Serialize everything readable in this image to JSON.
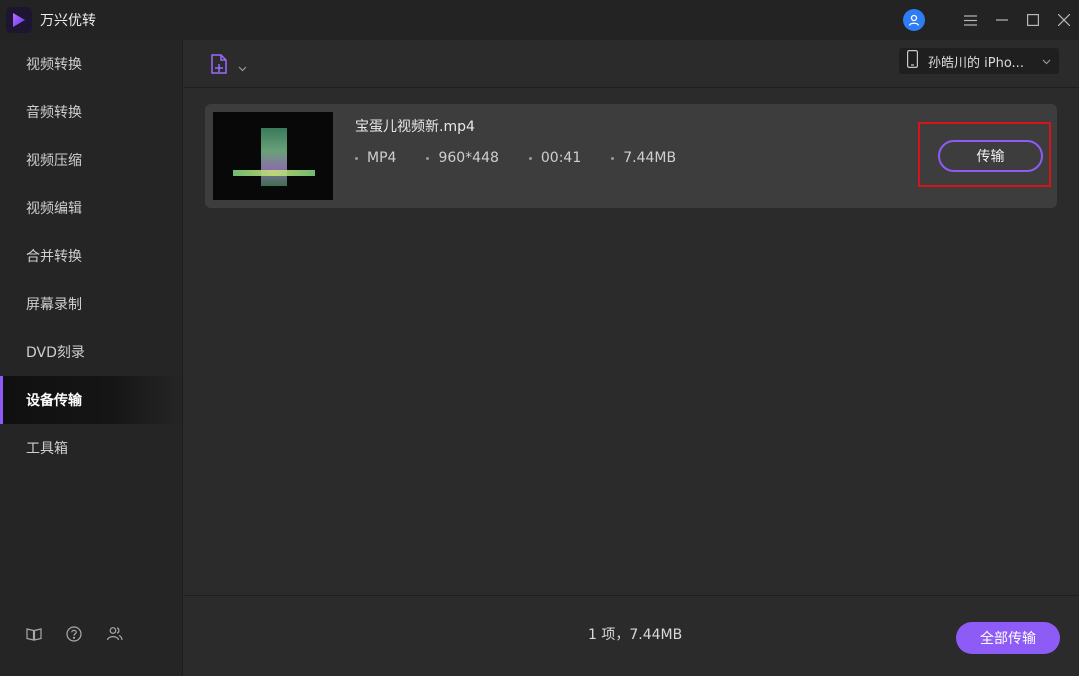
{
  "app": {
    "title": "万兴优转"
  },
  "sidebar": {
    "items": [
      {
        "label": "视频转换",
        "active": false
      },
      {
        "label": "音频转换",
        "active": false
      },
      {
        "label": "视频压缩",
        "active": false
      },
      {
        "label": "视频编辑",
        "active": false
      },
      {
        "label": "合并转换",
        "active": false
      },
      {
        "label": "屏幕录制",
        "active": false
      },
      {
        "label": "DVD刻录",
        "active": false
      },
      {
        "label": "设备传输",
        "active": true
      },
      {
        "label": "工具箱",
        "active": false
      }
    ],
    "bottom_icons": [
      "book-icon",
      "help-icon",
      "users-icon"
    ]
  },
  "toolbar": {
    "add_file_icon": "add-file-icon",
    "device_label": "孙皓川的 iPho..."
  },
  "file": {
    "name": "宝蛋儿视频新.mp4",
    "format": "MP4",
    "resolution": "960*448",
    "duration": "00:41",
    "size": "7.44MB",
    "transfer_label": "传输"
  },
  "footer": {
    "summary": "1 项，7.44MB",
    "transfer_all_label": "全部传输"
  },
  "colors": {
    "accent": "#8d5cf6",
    "highlight": "#d7141c",
    "avatar": "#2e7cf6"
  }
}
